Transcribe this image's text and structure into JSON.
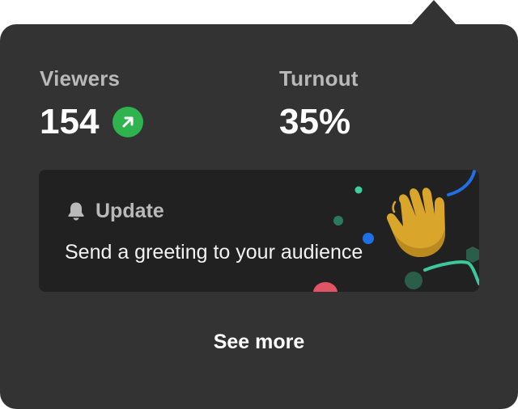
{
  "stats": {
    "viewers": {
      "label": "Viewers",
      "value": "154",
      "trend_icon": "arrow-up-right-icon",
      "trend_color": "#2fb34f"
    },
    "turnout": {
      "label": "Turnout",
      "value": "35%"
    }
  },
  "update": {
    "icon": "bell-icon",
    "title": "Update",
    "message": "Send a greeting to your audience",
    "illustration_icon": "waving-hand-icon"
  },
  "footer": {
    "see_more_label": "See more"
  },
  "colors": {
    "popover_bg": "#333333",
    "card_bg": "#212121",
    "label": "#b9b9b9",
    "value": "#ffffff",
    "accent_green": "#2fb34f",
    "accent_blue": "#1f6fe6"
  }
}
